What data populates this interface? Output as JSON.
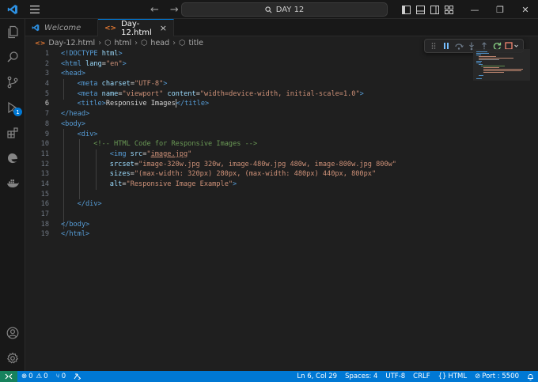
{
  "titlebar": {
    "search_text": "DAY 12",
    "back_arrow": "←",
    "forward_arrow": "→",
    "minimize": "—",
    "restore": "❐",
    "close": "✕"
  },
  "tabs": [
    {
      "label": "Welcome",
      "active": false
    },
    {
      "label": "Day-12.html",
      "active": true
    }
  ],
  "breadcrumb": [
    "Day-12.html",
    "html",
    "head",
    "title"
  ],
  "activity": {
    "run_badge": "1"
  },
  "editor": {
    "line_numbers": [
      "1",
      "2",
      "3",
      "4",
      "5",
      "6",
      "7",
      "8",
      "9",
      "10",
      "11",
      "12",
      "13",
      "14",
      "15",
      "16",
      "17",
      "18",
      "19"
    ],
    "current_line": 6,
    "lines": {
      "l1_a": "<!DOCTYPE ",
      "l1_b": "html",
      "l1_c": ">",
      "l2_a": "<html ",
      "l2_b": "lang",
      "l2_c": "=",
      "l2_d": "\"en\"",
      "l2_e": ">",
      "l3_a": "<head>",
      "l4_a": "<meta ",
      "l4_b": "charset",
      "l4_c": "=",
      "l4_d": "\"UTF-8\"",
      "l4_e": ">",
      "l5_a": "<meta ",
      "l5_b": "name",
      "l5_c": "=",
      "l5_d": "\"viewport\"",
      "l5_e": " content",
      "l5_f": "=",
      "l5_g": "\"width=device-width, initial-scale=1.0\"",
      "l5_h": ">",
      "l6_a": "<title>",
      "l6_b": "Responsive Images",
      "l6_c": "</title>",
      "l7_a": "</head>",
      "l8_a": "<body>",
      "l9_a": "<div>",
      "l10_a": "<!-- HTML Code for Responsive Images -->",
      "l11_a": "<img ",
      "l11_b": "src",
      "l11_c": "=",
      "l11_d": "\"",
      "l11_e": "image.jpg",
      "l11_f": "\"",
      "l12_a": "srcset",
      "l12_b": "=",
      "l12_c": "\"image-320w.jpg 320w, image-480w.jpg 480w, image-800w.jpg 800w\"",
      "l13_a": "sizes",
      "l13_b": "=",
      "l13_c": "\"(max-width: 320px) 280px, (max-width: 480px) 440px, 800px\"",
      "l14_a": "alt",
      "l14_b": "=",
      "l14_c": "\"Responsive Image Example\"",
      "l14_d": ">",
      "l16_a": "</div>",
      "l18_a": "</body>",
      "l19_a": "</html>"
    }
  },
  "status": {
    "errors": "0",
    "warnings": "0",
    "ports_count": "0",
    "position": "Ln 6, Col 29",
    "spaces": "Spaces: 4",
    "encoding": "UTF-8",
    "eol": "CRLF",
    "language": "HTML",
    "port": "Port : 5500"
  },
  "colors": {
    "accent": "#0078d4",
    "tag": "#569cd6",
    "attribute": "#9cdcfe",
    "string": "#ce9178",
    "comment": "#6a9955",
    "debug_restart": "#89d185",
    "debug_stop": "#f48771"
  },
  "icons": [
    "vscode-logo-icon",
    "menu-icon",
    "search-icon",
    "layout-icons",
    "explorer-icon",
    "search-view-icon",
    "source-control-icon",
    "run-debug-icon",
    "extensions-icon",
    "edge-icon",
    "docker-icon",
    "account-icon",
    "settings-gear-icon",
    "html-file-icon",
    "symbol-icon"
  ]
}
